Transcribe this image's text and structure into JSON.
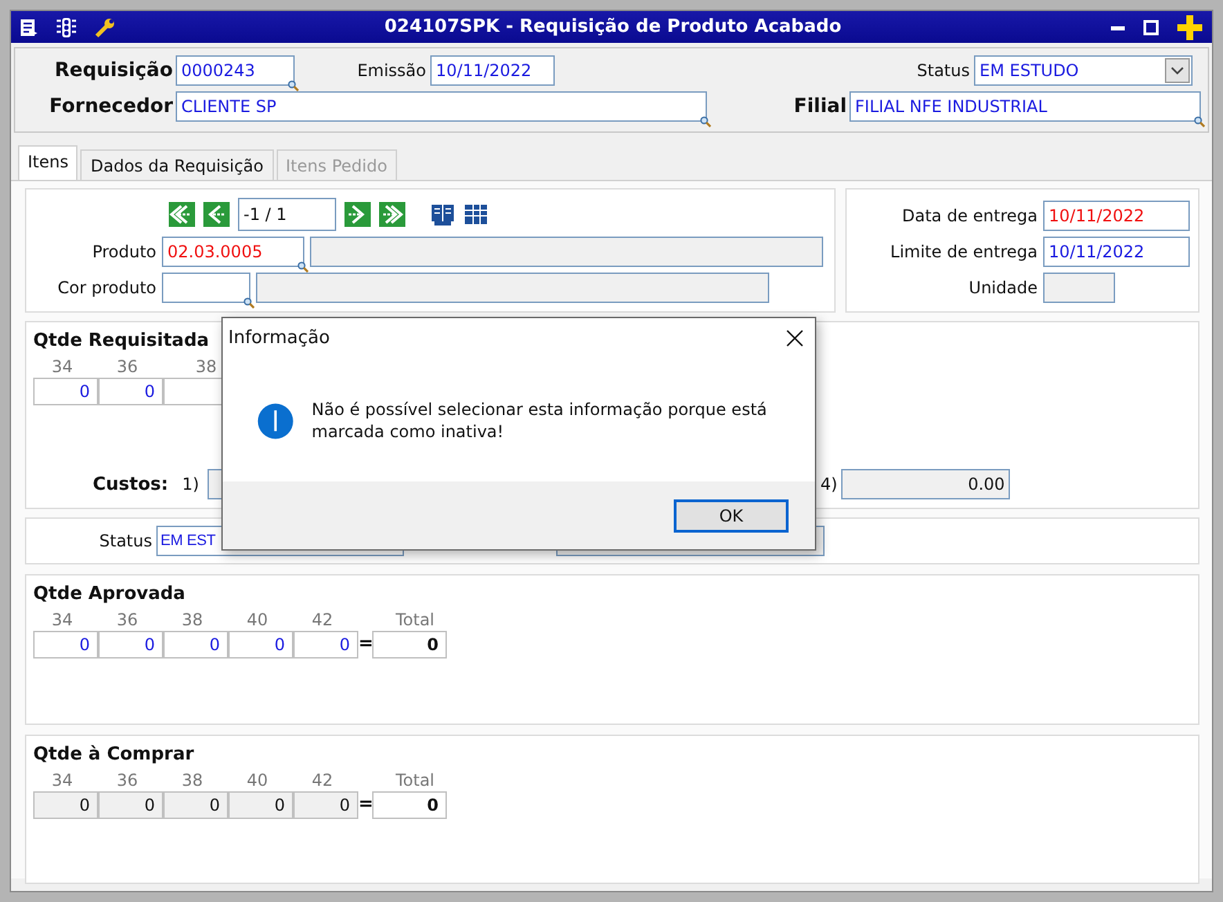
{
  "window": {
    "title": "024107SPK - Requisição de Produto Acabado"
  },
  "header": {
    "requisicao": {
      "label": "Requisição",
      "value": "0000243"
    },
    "emissao": {
      "label": "Emissão",
      "value": "10/11/2022"
    },
    "status": {
      "label": "Status",
      "value": "EM ESTUDO"
    },
    "fornecedor": {
      "label": "Fornecedor",
      "value": "CLIENTE SP"
    },
    "filial": {
      "label": "Filial",
      "value": "FILIAL NFE INDUSTRIAL"
    }
  },
  "tabs": [
    {
      "label": "Itens",
      "selected": true,
      "disabled": false
    },
    {
      "label": "Dados da Requisição",
      "selected": false,
      "disabled": false
    },
    {
      "label": "Itens Pedido",
      "selected": false,
      "disabled": true
    }
  ],
  "navigator": {
    "position": "-1 / 1"
  },
  "product": {
    "produto": {
      "label": "Produto",
      "value": "02.03.0005",
      "required": true
    },
    "cor": {
      "label": "Cor produto"
    }
  },
  "delivery": {
    "data_entrega": {
      "label": "Data de entrega",
      "value": "10/11/2022",
      "required": true
    },
    "limite": {
      "label": "Limite de entrega",
      "value": "10/11/2022",
      "required": false
    },
    "unidade": {
      "label": "Unidade"
    }
  },
  "qtde_requisitada": {
    "title": "Qtde Requisitada",
    "sizes": [
      "34",
      "36",
      "38"
    ],
    "values": [
      "0",
      "0"
    ],
    "editable": true
  },
  "custos": {
    "label": "Custos:",
    "first_index": "1)",
    "last_index": "4)",
    "last_value": "0.00"
  },
  "status_row": {
    "label": "Status",
    "value": "EM EST"
  },
  "qtde_aprovada": {
    "title": "Qtde Aprovada",
    "sizes": [
      "34",
      "36",
      "38",
      "40",
      "42"
    ],
    "values": [
      "0",
      "0",
      "0",
      "0",
      "0"
    ],
    "equals": "=",
    "total_label": "Total",
    "total": "0",
    "editable": true
  },
  "qtde_comprar": {
    "title": "Qtde à Comprar",
    "sizes": [
      "34",
      "36",
      "38",
      "40",
      "42"
    ],
    "values": [
      "0",
      "0",
      "0",
      "0",
      "0"
    ],
    "equals": "=",
    "total_label": "Total",
    "total": "0",
    "editable": false
  },
  "dialog": {
    "title": "Informação",
    "message": "Não é possível selecionar esta informação porque está marcada como inativa!",
    "button": "OK"
  }
}
